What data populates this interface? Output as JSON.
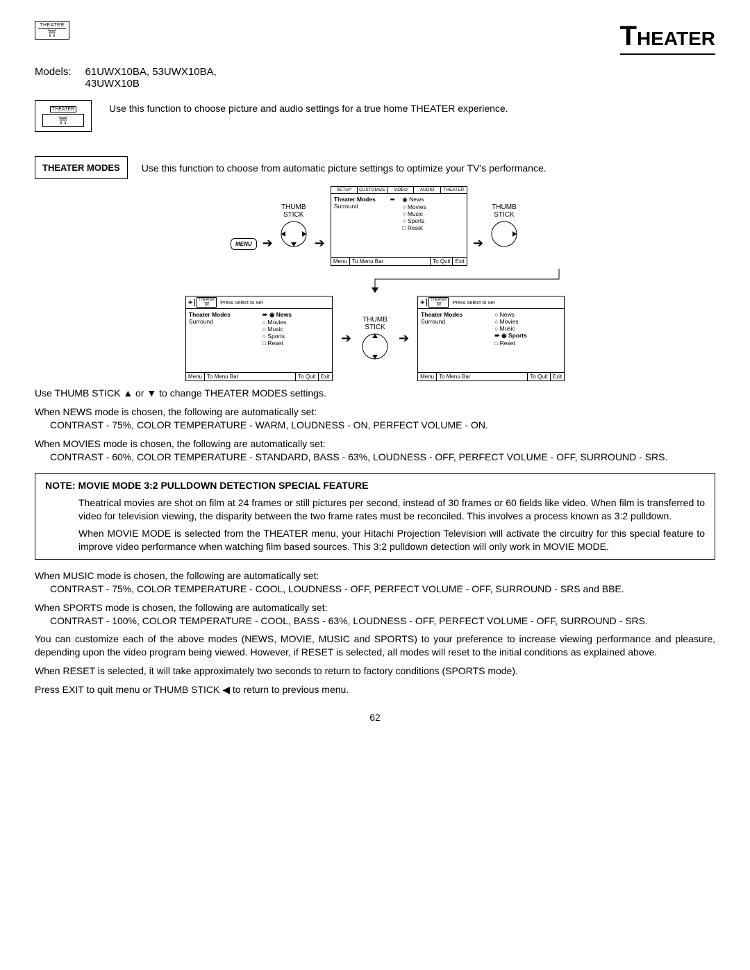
{
  "header": {
    "logo_top": "THEATER",
    "logo_bot": "⛩",
    "title": "Theater"
  },
  "models": {
    "label": "Models:",
    "list_line1": "61UWX10BA, 53UWX10BA,",
    "list_line2": "43UWX10B"
  },
  "intro": {
    "icon_top": "THEATER",
    "icon_bot": "⛩",
    "text": "Use this function to choose picture and audio settings for a true home THEATER experience."
  },
  "modes": {
    "label": "THEATER MODES",
    "text": "Use this function to choose from automatic picture settings to optimize your TV's performance."
  },
  "diagram": {
    "thumb": "THUMB",
    "stick": "STICK",
    "menu_btn": "MENU",
    "screen_main": {
      "tabs": [
        "SETUP",
        "CUSTOMIZE",
        "VIDEO",
        "AUDIO",
        "THEATER"
      ],
      "left": [
        "Theater Modes",
        "Surround"
      ],
      "right": [
        "News",
        "Movies",
        "Music",
        "Sports",
        "Reset"
      ],
      "footer": [
        "Menu",
        "To Menu Bar",
        "To Quit",
        "Exit"
      ]
    },
    "screen_sub": {
      "header_badge": "THEATER",
      "header_text": "Press select to set",
      "left": [
        "Theater Modes",
        "Surround"
      ],
      "right": [
        "News",
        "Movies",
        "Music",
        "Sports",
        "Reset"
      ],
      "footer": [
        "Menu",
        "To Menu Bar",
        "To Quit",
        "Exit"
      ]
    }
  },
  "body": {
    "p1": "Use THUMB STICK ▲ or ▼ to change THEATER MODES settings.",
    "p2a": "When NEWS mode is chosen, the following are automatically set:",
    "p2b": "CONTRAST - 75%, COLOR TEMPERATURE - WARM, LOUDNESS - ON, PERFECT VOLUME - ON.",
    "p3a": "When MOVIES mode is chosen, the following are automatically set:",
    "p3b": "CONTRAST - 60%, COLOR TEMPERATURE - STANDARD, BASS - 63%, LOUDNESS - OFF, PERFECT VOLUME - OFF, SURROUND - SRS.",
    "note_label": "NOTE:",
    "note_title": "MOVIE MODE 3:2 PULLDOWN DETECTION SPECIAL FEATURE",
    "note_p1": "Theatrical movies are shot on film at 24 frames or still pictures per second, instead of 30 frames or 60 fields like video.  When film is transferred to video for television viewing, the disparity between the two frame rates must be reconciled.  This involves a process known as 3:2 pulldown.",
    "note_p2": "When MOVIE MODE is selected from the THEATER menu, your Hitachi Projection Television will activate the circuitry for this special feature to improve video performance when watching film based sources.  This 3:2 pulldown detection will only work in MOVIE MODE.",
    "p4a": "When MUSIC mode is chosen, the following are automatically set:",
    "p4b": "CONTRAST - 75%, COLOR TEMPERATURE - COOL, LOUDNESS - OFF, PERFECT VOLUME - OFF, SURROUND - SRS and BBE.",
    "p5a": "When SPORTS mode is chosen, the following are automatically set:",
    "p5b": "CONTRAST - 100%, COLOR TEMPERATURE - COOL, BASS - 63%, LOUDNESS - OFF, PERFECT VOLUME - OFF, SURROUND - SRS.",
    "p6": "You can customize each of the above modes (NEWS, MOVIE, MUSIC and SPORTS) to your preference to increase viewing performance and pleasure, depending upon the video program being viewed. However, if RESET is selected, all modes will reset to the initial conditions as explained above.",
    "p7": "When RESET is selected, it will take approximately two seconds to return to factory conditions (SPORTS mode).",
    "p8": "Press EXIT to quit menu or THUMB STICK ◀ to return to previous menu."
  },
  "page_number": "62"
}
